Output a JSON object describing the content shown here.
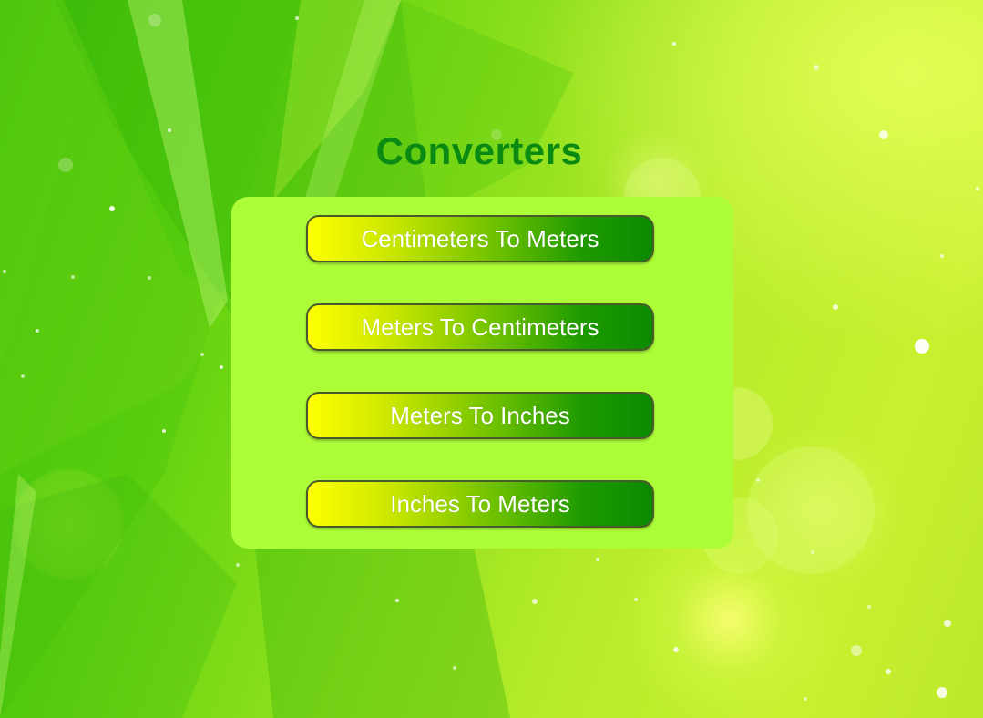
{
  "page": {
    "title": "Converters"
  },
  "converters": [
    {
      "label": "Centimeters To Meters"
    },
    {
      "label": "Meters To Centimeters"
    },
    {
      "label": "Meters To Inches"
    },
    {
      "label": "Inches To Meters"
    }
  ],
  "colors": {
    "title": "#0a8a12",
    "panel": "#acfd38",
    "button_gradient_start": "#ffff00",
    "button_gradient_end": "#0b8a00",
    "button_text": "#ffffff"
  }
}
